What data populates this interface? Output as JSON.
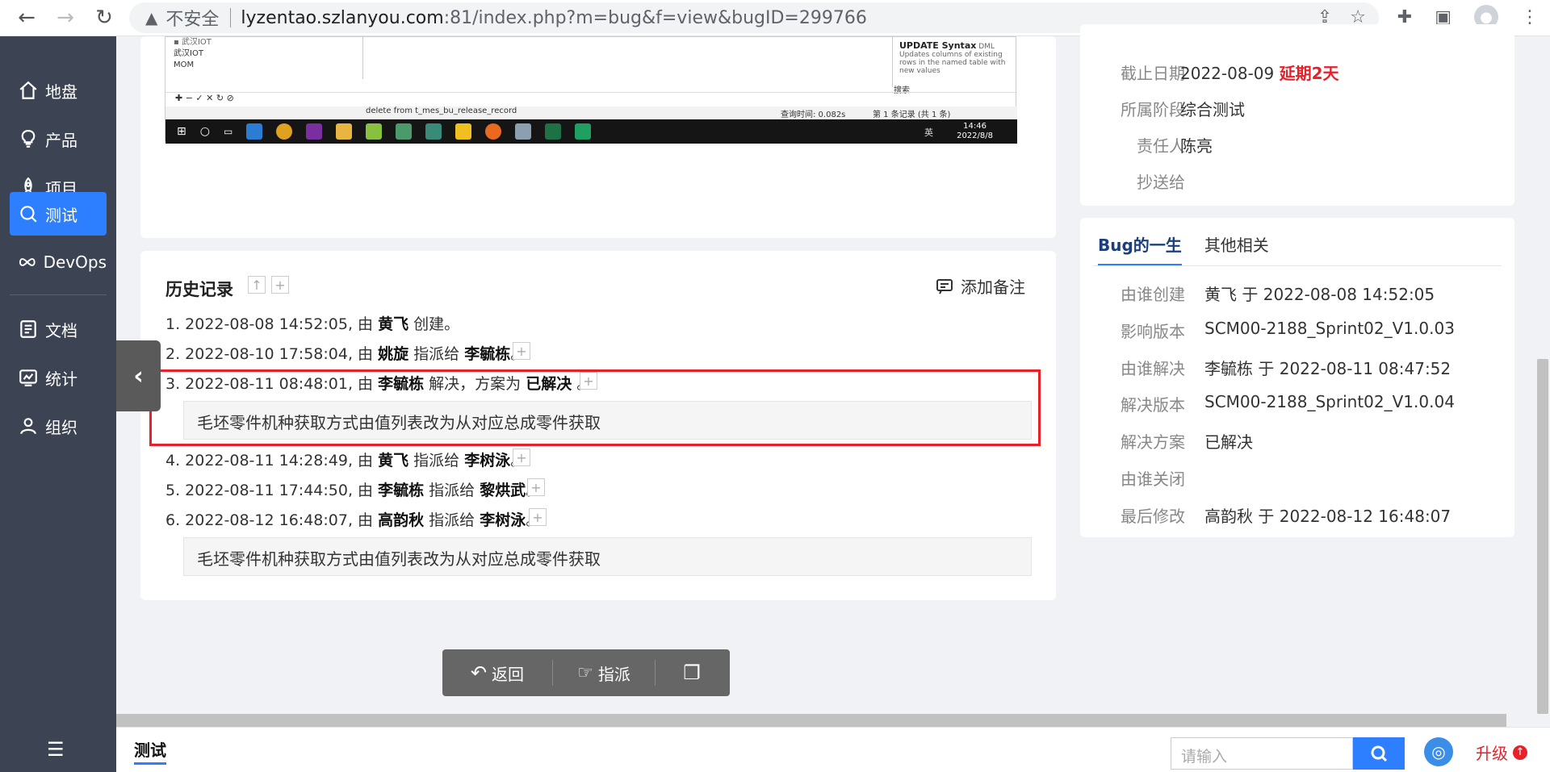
{
  "browser": {
    "security_label": "不安全",
    "url_host": "lyzentao.szlanyou.com",
    "url_path": ":81/index.php?m=bug&f=view&bugID=299766"
  },
  "sidebar": {
    "items": [
      {
        "label": "地盘",
        "icon": "home-icon"
      },
      {
        "label": "产品",
        "icon": "lightbulb-icon"
      },
      {
        "label": "项目",
        "icon": "rocket-icon"
      },
      {
        "label": "测试",
        "icon": "search-icon",
        "active": true
      },
      {
        "label": "DevOps",
        "icon": "infinity-icon"
      },
      {
        "label": "文档",
        "icon": "document-icon"
      },
      {
        "label": "统计",
        "icon": "chart-icon"
      },
      {
        "label": "组织",
        "icon": "user-icon"
      }
    ]
  },
  "screenshot": {
    "list_items": [
      "武汉IOT",
      "MOM"
    ],
    "hint_title": "UPDATE Syntax",
    "hint_tag": "DML",
    "hint_desc": "Updates columns of existing rows in the named table with new values",
    "hint_search": "搜索",
    "sql_text": "delete from t_mes_bu_release_record",
    "query_time": "查询时间: 0.082s",
    "record_info": "第 1 条记录 (共 1 条)",
    "tray_text": "英",
    "time": "14:46",
    "date": "2022/8/8"
  },
  "history": {
    "title": "历史记录",
    "add_note": "添加备注",
    "entries": [
      {
        "prefix": "1. 2022-08-08 14:52:05, 由 ",
        "actor": "黄飞",
        "action": " 创建。",
        "target": "",
        "suffix": ""
      },
      {
        "prefix": "2. 2022-08-10 17:58:04, 由 ",
        "actor": "姚旋",
        "action": " 指派给 ",
        "target": "李毓栋",
        "suffix": "。"
      },
      {
        "prefix": "3. 2022-08-11 08:48:01, 由 ",
        "actor": "李毓栋",
        "action": " 解决，方案为 ",
        "target": "已解决",
        "suffix": " 。"
      },
      {
        "prefix": "4. 2022-08-11 14:28:49, 由 ",
        "actor": "黄飞",
        "action": " 指派给 ",
        "target": "李树泳",
        "suffix": "。"
      },
      {
        "prefix": "5. 2022-08-11 17:44:50, 由 ",
        "actor": "李毓栋",
        "action": " 指派给 ",
        "target": "黎烘武",
        "suffix": "。"
      },
      {
        "prefix": "6. 2022-08-12 16:48:07, 由 ",
        "actor": "高韵秋",
        "action": " 指派给 ",
        "target": "李树泳",
        "suffix": "。"
      }
    ],
    "comment_3": "毛坯零件机种获取方式由值列表改为从对应总成零件获取",
    "comment_6": "毛坯零件机种获取方式由值列表改为从对应总成零件获取"
  },
  "toolbar": {
    "back_label": "返回",
    "assign_label": "指派"
  },
  "basic_info": {
    "deadline_label": "截止日期",
    "deadline_value": "2022-08-09",
    "deadline_delay": "延期2天",
    "stage_label": "所属阶段",
    "stage_value": "综合测试",
    "owner_label": "责任人",
    "owner_value": "陈亮",
    "cc_label": "抄送给",
    "cc_value": ""
  },
  "life": {
    "tab_active": "Bug的一生",
    "tab_other": "其他相关",
    "rows": [
      {
        "label": "由谁创建",
        "value": "黄飞 于 2022-08-08 14:52:05"
      },
      {
        "label": "影响版本",
        "value": "SCM00-2188_Sprint02_V1.0.03"
      },
      {
        "label": "由谁解决",
        "value": "李毓栋 于 2022-08-11 08:47:52"
      },
      {
        "label": "解决版本",
        "value": "SCM00-2188_Sprint02_V1.0.04"
      },
      {
        "label": "解决方案",
        "value": "已解决"
      },
      {
        "label": "由谁关闭",
        "value": ""
      },
      {
        "label": "最后修改",
        "value": "高韵秋 于 2022-08-12 16:48:07"
      }
    ]
  },
  "footer": {
    "breadcrumb": "测试",
    "search_placeholder": "请输入",
    "upgrade_label": "升级"
  }
}
